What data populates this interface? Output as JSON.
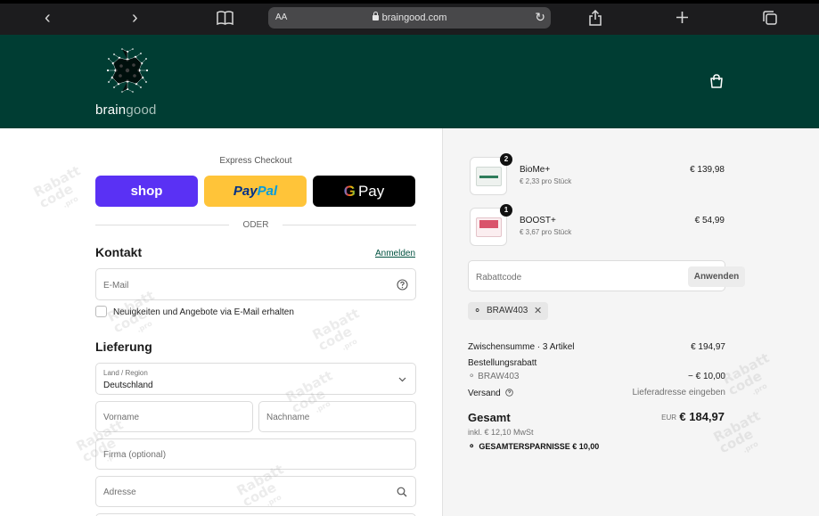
{
  "browser": {
    "aa_label": "AA",
    "domain": "braingood.com"
  },
  "header": {
    "logo_text_a": "brain",
    "logo_text_b": "good"
  },
  "checkout": {
    "express_title": "Express Checkout",
    "shop_label": "shop",
    "paypal_a": "Pay",
    "paypal_b": "Pal",
    "gpay_label": "Pay",
    "divider": "ODER"
  },
  "contact": {
    "title": "Kontakt",
    "login_link": "Anmelden",
    "email_placeholder": "E-Mail",
    "newsletter_label": "Neuigkeiten und Angebote via E-Mail erhalten"
  },
  "delivery": {
    "title": "Lieferung",
    "country_label": "Land / Region",
    "country_value": "Deutschland",
    "firstname_placeholder": "Vorname",
    "lastname_placeholder": "Nachname",
    "company_placeholder": "Firma (optional)",
    "address_placeholder": "Adresse"
  },
  "cart": {
    "items": [
      {
        "name": "BioMe+",
        "unit": "€ 2,33 pro Stück",
        "price": "€ 139,98",
        "qty": "2"
      },
      {
        "name": "BOOST+",
        "unit": "€ 3,67 pro Stück",
        "price": "€ 54,99",
        "qty": "1"
      }
    ],
    "coupon_placeholder": "Rabattcode",
    "apply_label": "Anwenden",
    "applied_code": "BRAW403"
  },
  "summary": {
    "subtotal_label": "Zwischensumme · 3 Artikel",
    "subtotal_value": "€ 194,97",
    "discount_label": "Bestellungsrabatt",
    "discount_code": "BRAW403",
    "discount_value": "− € 10,00",
    "shipping_label": "Versand",
    "shipping_value": "Lieferadresse eingeben",
    "total_label": "Gesamt",
    "currency": "EUR",
    "total_value": "€ 184,97",
    "tax": "inkl. € 12,10 MwSt",
    "savings": "GESAMTERSPARNISSE € 10,00"
  },
  "watermark": {
    "line1": "Rabatt",
    "line2": "code",
    "line3": ".pro"
  },
  "colors": {
    "header_bg": "#003d33",
    "shop_purple": "#5a31f4",
    "paypal_yellow": "#ffc439",
    "link_green": "#00513f"
  }
}
